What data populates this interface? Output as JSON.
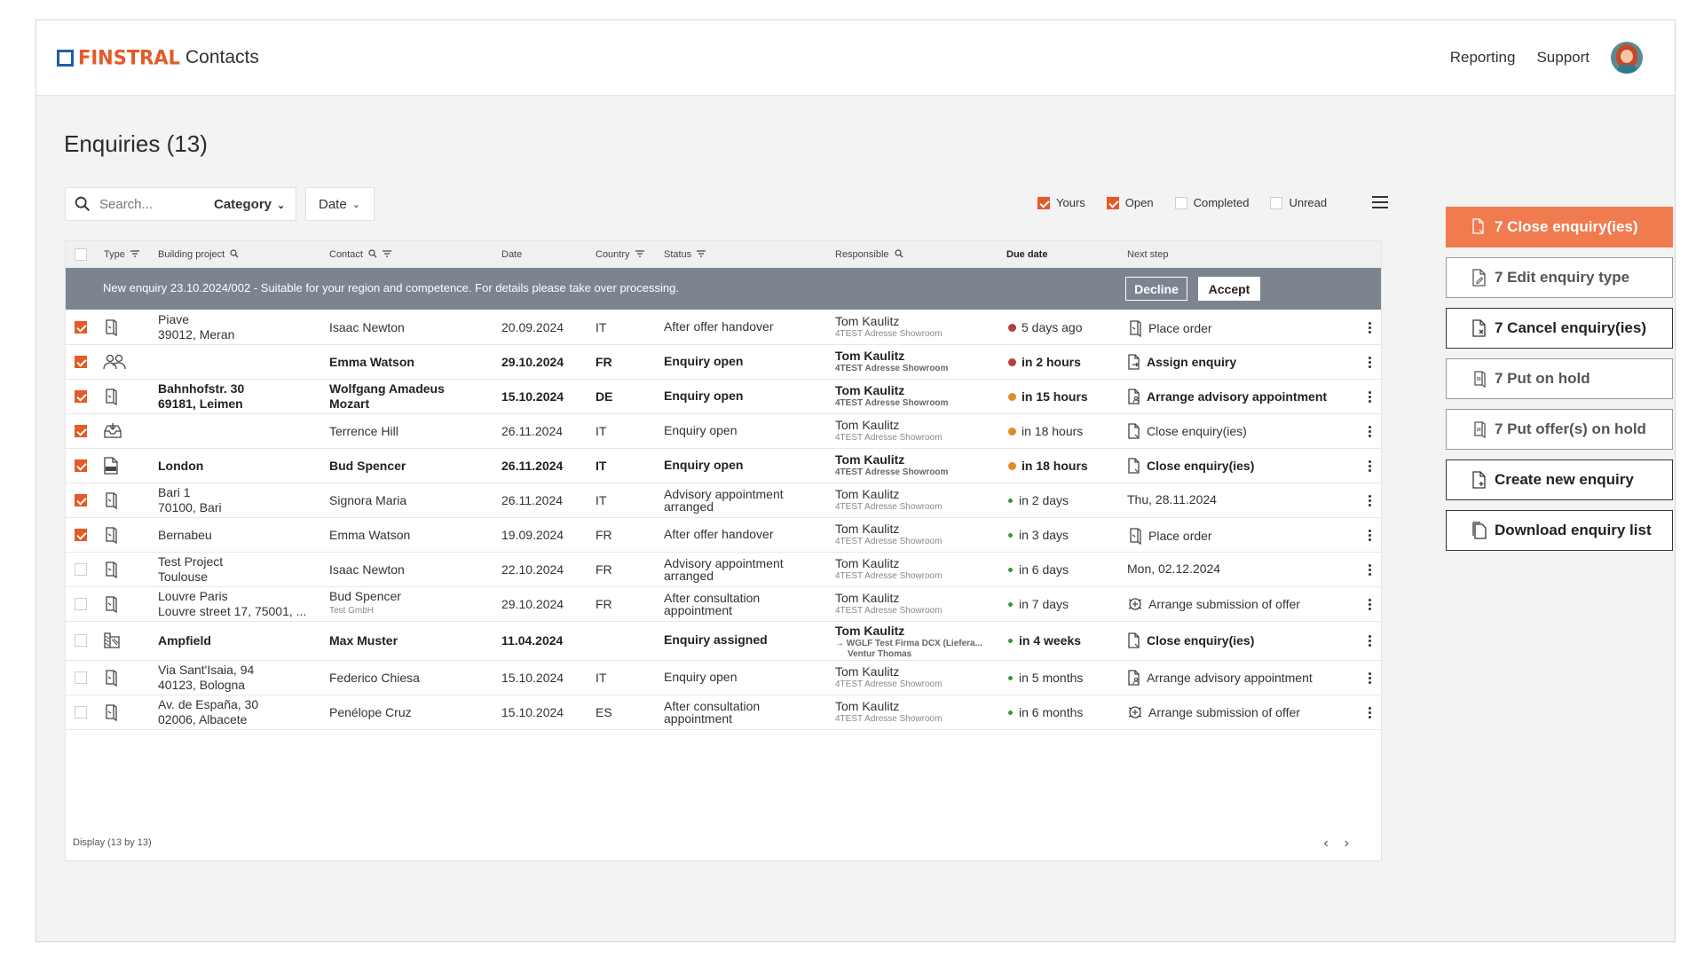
{
  "app": {
    "brand": "FINSTRAL",
    "name": "Contacts"
  },
  "nav": {
    "reporting": "Reporting",
    "support": "Support"
  },
  "page": {
    "title": "Enquiries (13)"
  },
  "toolbar": {
    "search_placeholder": "Search...",
    "category_label": "Category",
    "date_label": "Date"
  },
  "filters": [
    {
      "label": "Yours",
      "checked": true
    },
    {
      "label": "Open",
      "checked": true
    },
    {
      "label": "Completed",
      "checked": false
    },
    {
      "label": "Unread",
      "checked": false
    }
  ],
  "columns": {
    "type": "Type",
    "building_project": "Building project",
    "contact": "Contact",
    "date": "Date",
    "country": "Country",
    "status": "Status",
    "responsible": "Responsible",
    "due_date": "Due date",
    "next_step": "Next step"
  },
  "banner": {
    "message": "New enquiry 23.10.2024/002 - Suitable for your region and competence. For details please take over processing.",
    "decline": "Decline",
    "accept": "Accept"
  },
  "rows": [
    {
      "checked": true,
      "bold": false,
      "type_icon": "window-icon",
      "project1": "Piave",
      "project2": "39012, Meran",
      "contact1": "Isaac Newton",
      "contact2": "",
      "date": "20.09.2024",
      "country": "IT",
      "status1": "After offer handover",
      "status2": "",
      "resp1": "Tom Kaulitz",
      "resp2": "4TEST Adresse Showroom",
      "resp3": "",
      "due": "5 days ago",
      "due_color": "#b0413e",
      "due_dot": "big",
      "next_icon": "window-icon",
      "next": "Place order"
    },
    {
      "checked": true,
      "bold": true,
      "type_icon": "people-icon",
      "project1": "",
      "project2": "",
      "contact1": "Emma Watson",
      "contact2": "",
      "date": "29.10.2024",
      "country": "FR",
      "status1": "Enquiry open",
      "status2": "",
      "resp1": "Tom Kaulitz",
      "resp2": "4TEST Adresse Showroom",
      "resp3": "",
      "due": "in 2 hours",
      "due_color": "#b0413e",
      "due_dot": "big",
      "next_icon": "document-arrow-icon",
      "next": "Assign enquiry"
    },
    {
      "checked": true,
      "bold": true,
      "type_icon": "window-icon",
      "project1": "Bahnhofstr. 30",
      "project2": "69181, Leimen",
      "contact1": "Wolfgang Amadeus",
      "contact2": "Mozart",
      "date": "15.10.2024",
      "country": "DE",
      "status1": "Enquiry open",
      "status2": "",
      "resp1": "Tom Kaulitz",
      "resp2": "4TEST Adresse Showroom",
      "resp3": "",
      "due": "in 15 hours",
      "due_color": "#e08a2c",
      "due_dot": "big",
      "next_icon": "document-person-icon",
      "next": "Arrange advisory appointment"
    },
    {
      "checked": true,
      "bold": false,
      "type_icon": "inbox-icon",
      "project1": "",
      "project2": "",
      "contact1": "Terrence Hill",
      "contact2": "",
      "date": "26.11.2024",
      "country": "IT",
      "status1": "Enquiry open",
      "status2": "",
      "resp1": "Tom Kaulitz",
      "resp2": "4TEST Adresse Showroom",
      "resp3": "",
      "due": "in 18 hours",
      "due_color": "#e08a2c",
      "due_dot": "big",
      "next_icon": "document-close-icon",
      "next": "Close enquiry(ies)"
    },
    {
      "checked": true,
      "bold": true,
      "type_icon": "dwg-file-icon",
      "project1": "London",
      "project2": "",
      "contact1": "Bud Spencer",
      "contact2": "",
      "date": "26.11.2024",
      "country": "IT",
      "status1": "Enquiry open",
      "status2": "",
      "resp1": "Tom Kaulitz",
      "resp2": "4TEST Adresse Showroom",
      "resp3": "",
      "due": "in 18 hours",
      "due_color": "#e08a2c",
      "due_dot": "big",
      "next_icon": "document-close-icon",
      "next": "Close enquiry(ies)"
    },
    {
      "checked": true,
      "bold": false,
      "type_icon": "window-icon",
      "project1": "Bari 1",
      "project2": "70100, Bari",
      "contact1": "Signora Maria",
      "contact2": "",
      "date": "26.11.2024",
      "country": "IT",
      "status1": "Advisory appointment",
      "status2": "arranged",
      "resp1": "Tom Kaulitz",
      "resp2": "4TEST Adresse Showroom",
      "resp3": "",
      "due": "in 2 days",
      "due_color": "#2e9b3a",
      "due_dot": "small",
      "next_icon": "",
      "next": "Thu, 28.11.2024"
    },
    {
      "checked": true,
      "bold": false,
      "type_icon": "window-icon",
      "project1": "Bernabeu",
      "project2": "",
      "contact1": "Emma Watson",
      "contact2": "",
      "date": "19.09.2024",
      "country": "FR",
      "status1": "After offer handover",
      "status2": "",
      "resp1": "Tom Kaulitz",
      "resp2": "4TEST Adresse Showroom",
      "resp3": "",
      "due": "in 3 days",
      "due_color": "#2e9b3a",
      "due_dot": "small",
      "next_icon": "window-icon",
      "next": "Place order"
    },
    {
      "checked": false,
      "bold": false,
      "type_icon": "window-icon",
      "project1": "Test Project",
      "project2": "Toulouse",
      "contact1": "Isaac Newton",
      "contact2": "",
      "date": "22.10.2024",
      "country": "FR",
      "status1": "Advisory appointment",
      "status2": "arranged",
      "resp1": "Tom Kaulitz",
      "resp2": "4TEST Adresse Showroom",
      "resp3": "",
      "due": "in 6 days",
      "due_color": "#2e9b3a",
      "due_dot": "small",
      "next_icon": "",
      "next": "Mon, 02.12.2024"
    },
    {
      "checked": false,
      "bold": false,
      "type_icon": "window-icon",
      "project1": "Louvre Paris",
      "project2": "Louvre street 17, 75001, ...",
      "contact1": "Bud Spencer",
      "contact2": "Test GmbH",
      "date": "29.10.2024",
      "country": "FR",
      "status1": "After consultation",
      "status2": "appointment",
      "resp1": "Tom Kaulitz",
      "resp2": "4TEST Adresse Showroom",
      "resp3": "",
      "due": "in 7 days",
      "due_color": "#2e9b3a",
      "due_dot": "small",
      "next_icon": "offer-submit-icon",
      "next": "Arrange submission of offer"
    },
    {
      "checked": false,
      "bold": true,
      "type_icon": "plan-icon",
      "project1": "Ampfield",
      "project2": "",
      "contact1": "Max Muster",
      "contact2": "",
      "date": "11.04.2024",
      "country": "",
      "status1": "Enquiry assigned",
      "status2": "",
      "resp1": "Tom Kaulitz",
      "resp2": "→ WGLF Test Firma DCX (Liefera...",
      "resp3": "Ventur Thomas",
      "due": "in 4 weeks",
      "due_color": "#2e9b3a",
      "due_dot": "small",
      "next_icon": "document-close-icon",
      "next": "Close enquiry(ies)"
    },
    {
      "checked": false,
      "bold": false,
      "type_icon": "window-icon",
      "project1": "Via Sant'Isaia, 94",
      "project2": "40123, Bologna",
      "contact1": "Federico Chiesa",
      "contact2": "",
      "date": "15.10.2024",
      "country": "IT",
      "status1": "Enquiry open",
      "status2": "",
      "resp1": "Tom Kaulitz",
      "resp2": "4TEST Adresse Showroom",
      "resp3": "",
      "due": "in 5 months",
      "due_color": "#2e9b3a",
      "due_dot": "small",
      "next_icon": "document-person-icon",
      "next": "Arrange advisory appointment"
    },
    {
      "checked": false,
      "bold": false,
      "type_icon": "window-icon",
      "project1": "Av. de España, 30",
      "project2": "02006, Albacete",
      "contact1": "Penélope Cruz",
      "contact2": "",
      "date": "15.10.2024",
      "country": "ES",
      "status1": "After consultation",
      "status2": "appointment",
      "resp1": "Tom Kaulitz",
      "resp2": "4TEST Adresse Showroom",
      "resp3": "",
      "due": "in 6 months",
      "due_color": "#2e9b3a",
      "due_dot": "small",
      "next_icon": "offer-submit-icon",
      "next": "Arrange submission of offer"
    }
  ],
  "footer": {
    "display": "Display  (13 by 13)",
    "prev": "‹",
    "next": "›"
  },
  "actions": [
    {
      "label": "7 Close enquiry(ies)",
      "style": "primary",
      "icon": "document-close-icon"
    },
    {
      "label": "7 Edit enquiry type",
      "style": "disabled",
      "icon": "document-edit-icon"
    },
    {
      "label": "7 Cancel enquiry(ies)",
      "style": "dark",
      "icon": "document-cancel-icon"
    },
    {
      "label": "7 Put on hold",
      "style": "disabled",
      "icon": "window-hold-icon"
    },
    {
      "label": "7 Put offer(s) on hold",
      "style": "disabled",
      "icon": "window-hold-icon"
    },
    {
      "label": "Create new enquiry",
      "style": "dark",
      "icon": "document-add-icon"
    },
    {
      "label": "Download enquiry list",
      "style": "dark",
      "icon": "document-download-icon"
    }
  ],
  "colors": {
    "accent": "#e55a27",
    "accent_button": "#f07b4f",
    "banner": "#7c8490",
    "brand_blue": "#1f5ea8"
  }
}
